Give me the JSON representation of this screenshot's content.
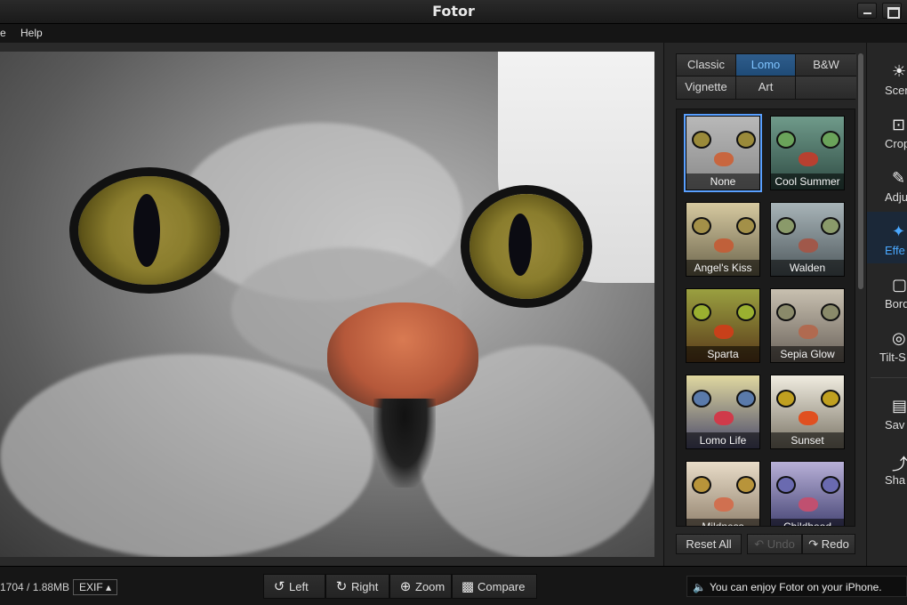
{
  "window": {
    "title": "Fotor"
  },
  "menu": {
    "items": [
      "e",
      "Help"
    ]
  },
  "effects_panel": {
    "tabs": [
      "Classic",
      "Lomo",
      "B&W",
      "Vignette",
      "Art",
      ""
    ],
    "active_tab": "Lomo",
    "effects": [
      {
        "label": "None",
        "selected": true
      },
      {
        "label": "Cool Summer",
        "selected": false
      },
      {
        "label": "Angel's Kiss",
        "selected": false
      },
      {
        "label": "Walden",
        "selected": false
      },
      {
        "label": "Sparta",
        "selected": false
      },
      {
        "label": "Sepia Glow",
        "selected": false
      },
      {
        "label": "Lomo Life",
        "selected": false
      },
      {
        "label": "Sunset",
        "selected": false
      },
      {
        "label": "Mildness",
        "selected": false
      },
      {
        "label": "Childhood",
        "selected": false
      }
    ],
    "reset_label": "Reset All",
    "undo_label": "Undo",
    "redo_label": "Redo"
  },
  "toolbar": {
    "items": [
      {
        "label": "Scen",
        "icon": "sun-icon"
      },
      {
        "label": "Crop",
        "icon": "crop-icon"
      },
      {
        "label": "Adju",
        "icon": "pencil-icon"
      },
      {
        "label": "Effe",
        "icon": "sparkle-icon"
      },
      {
        "label": "Bord",
        "icon": "border-icon"
      },
      {
        "label": "Tilt-S",
        "icon": "tilt-shift-icon"
      },
      {
        "label": "Sav",
        "icon": "save-icon"
      },
      {
        "label": "Sha",
        "icon": "share-icon"
      }
    ],
    "active": "Effe"
  },
  "status": {
    "dimensions": "1704 / 1.88MB",
    "exif_label": "EXIF ▴",
    "buttons": [
      "Left",
      "Right",
      "Zoom",
      "Compare"
    ],
    "notice": "You can enjoy Fotor on your iPhone."
  },
  "colors": {
    "accent": "#4aa8ff",
    "active_tab": "#2f5d8c"
  }
}
